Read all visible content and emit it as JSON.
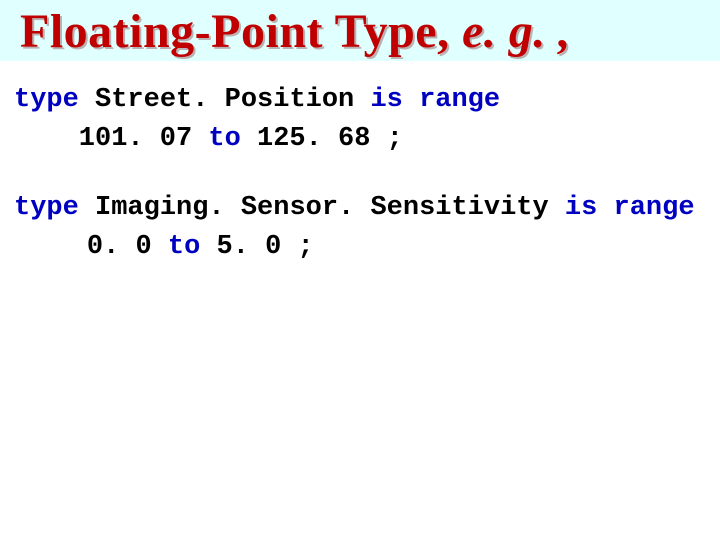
{
  "header": {
    "title_main": "Floating-Point Type, ",
    "title_eg": "e. g. ,"
  },
  "code": {
    "block1": {
      "kw_type": "type",
      "ident1": " Street. Position ",
      "kw_is": "is",
      "sp1": " ",
      "kw_range": "range",
      "val_lo": "101. 07 ",
      "kw_to": "to",
      "val_hi": " 125. 68 ;"
    },
    "block2": {
      "kw_type": "type",
      "ident1": " Imaging. Sensor. Sensitivity ",
      "kw_is": "is",
      "sp1": " ",
      "kw_range": "range",
      "val_lo": "0. 0 ",
      "kw_to": "to",
      "val_hi": " 5. 0 ;"
    }
  }
}
